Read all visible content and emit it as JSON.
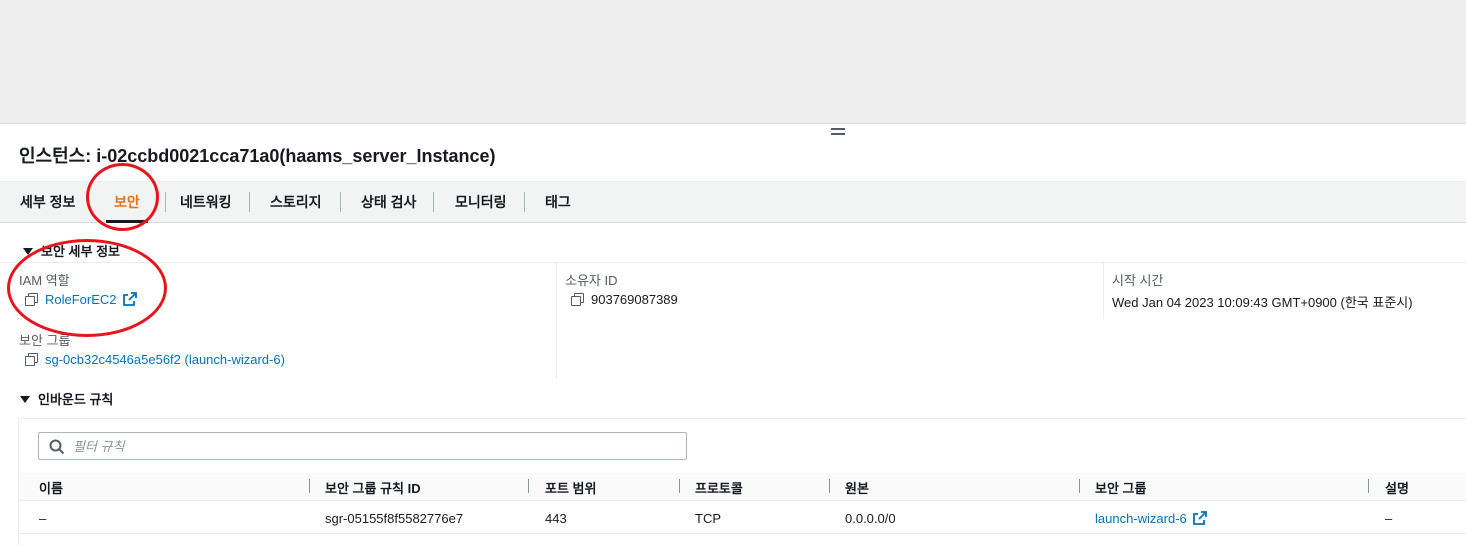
{
  "instance_title": "인스턴스: i-02ccbd0021cca71a0(haams_server_Instance)",
  "tabs": [
    {
      "label": "세부 정보"
    },
    {
      "label": "보안"
    },
    {
      "label": "네트워킹"
    },
    {
      "label": "스토리지"
    },
    {
      "label": "상태 검사"
    },
    {
      "label": "모니터링"
    },
    {
      "label": "태그"
    }
  ],
  "security_details": {
    "header": "보안 세부 정보",
    "iam_role_label": "IAM 역할",
    "iam_role_value": "RoleForEC2",
    "owner_id_label": "소유자 ID",
    "owner_id_value": "903769087389",
    "launch_time_label": "시작 시간",
    "launch_time_value": "Wed Jan 04 2023 10:09:43 GMT+0900 (한국 표준시)",
    "security_groups_label": "보안 그룹",
    "security_groups_value": "sg-0cb32c4546a5e56f2 (launch-wizard-6)"
  },
  "inbound_rules": {
    "header": "인바운드 규칙",
    "filter_placeholder": "필터 규칙",
    "columns": [
      "이름",
      "보안 그룹 규칙 ID",
      "포트 범위",
      "프로토콜",
      "원본",
      "보안 그룹",
      "설명"
    ],
    "rows": [
      {
        "name": "–",
        "rule_id": "sgr-05155f8f5582776e7",
        "port": "443",
        "protocol": "TCP",
        "source": "0.0.0.0/0",
        "security_group": "launch-wizard-6",
        "description": "–"
      }
    ]
  },
  "colors": {
    "accent": "#ec7211",
    "link": "#0073bb",
    "annotation": "#e8141c"
  }
}
